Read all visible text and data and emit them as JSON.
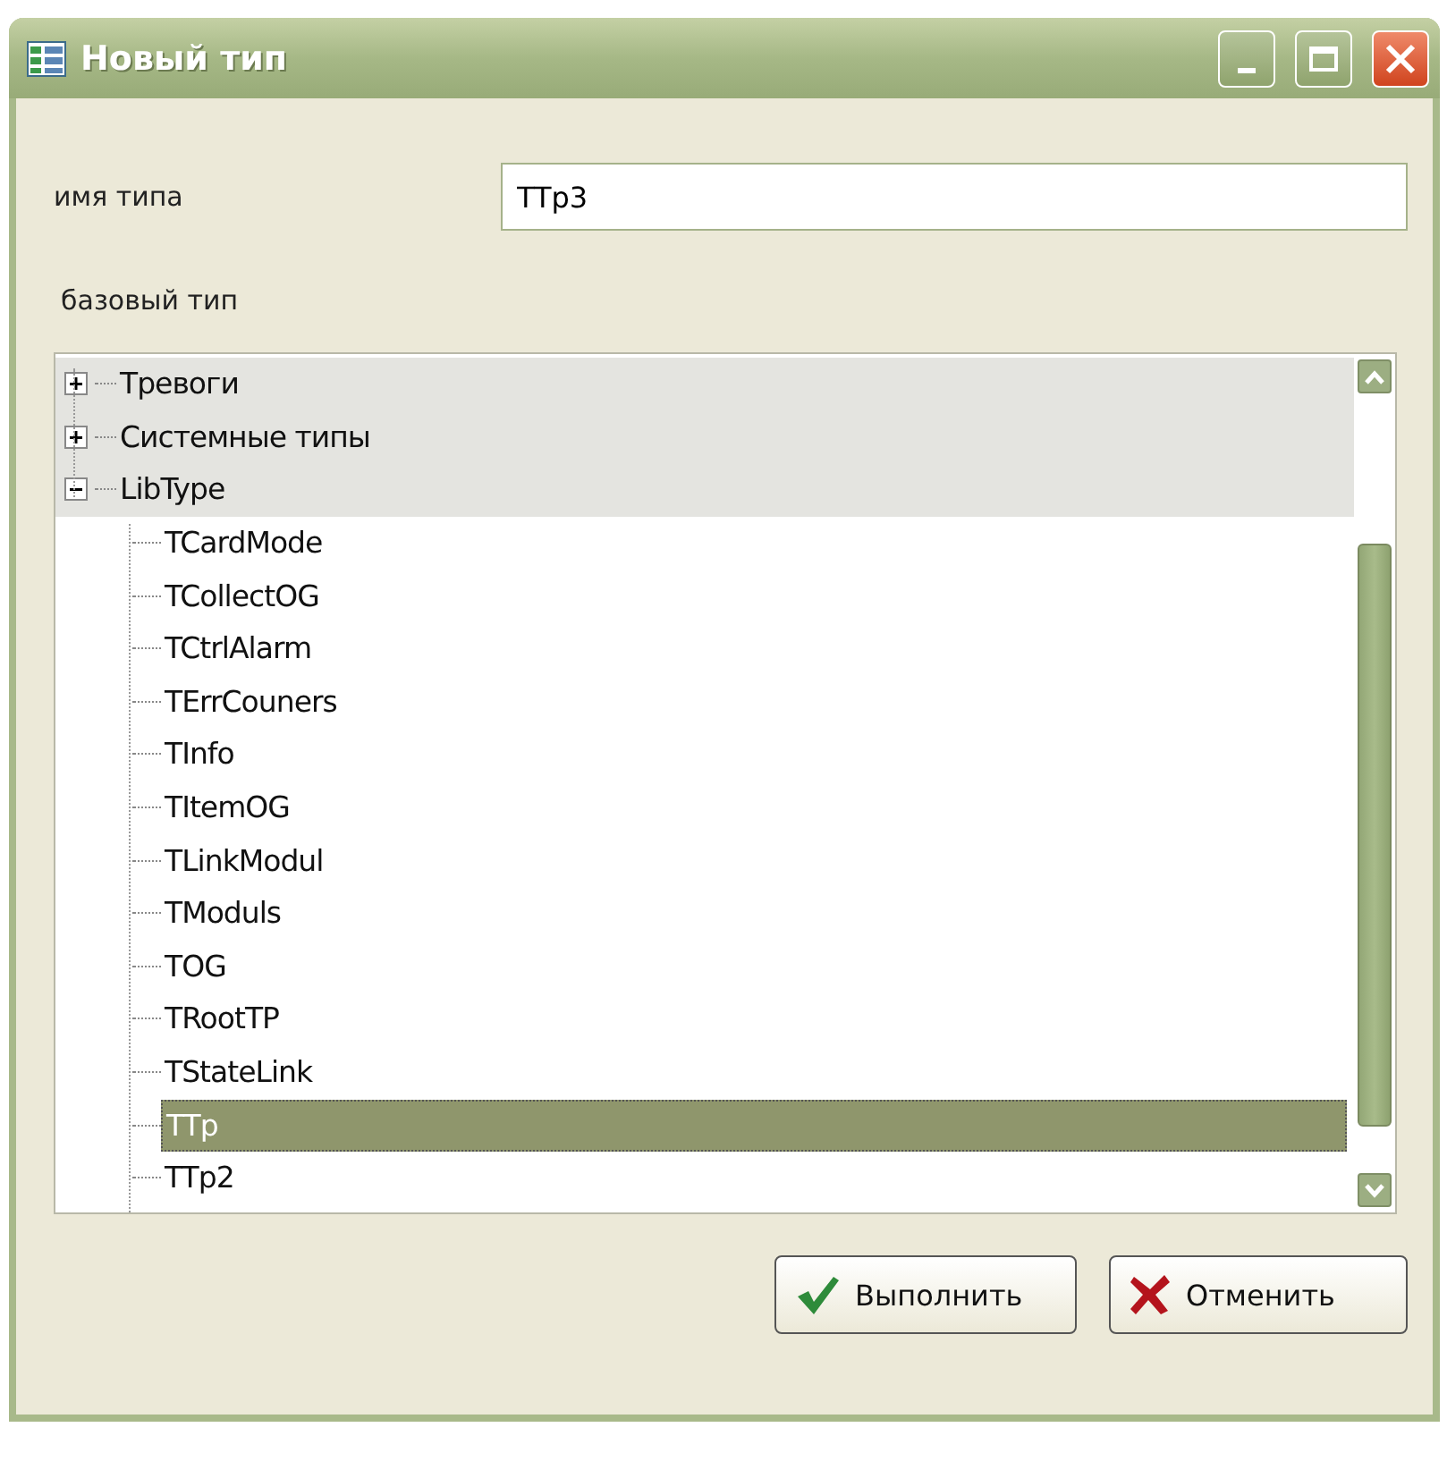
{
  "window": {
    "title": "Новый тип"
  },
  "type_name": {
    "label": "имя типа",
    "value": "TTp3"
  },
  "base_type": {
    "label": "базовый тип",
    "tree": [
      {
        "label": "Тревоги",
        "expanded": false,
        "selected": false
      },
      {
        "label": "Системные типы",
        "expanded": false,
        "selected": false
      },
      {
        "label": "LibType",
        "expanded": true,
        "selected": false,
        "children": [
          {
            "label": "TCardMode",
            "selected": false
          },
          {
            "label": "TCollectOG",
            "selected": false
          },
          {
            "label": "TCtrlAlarm",
            "selected": false
          },
          {
            "label": "TErrCouners",
            "selected": false
          },
          {
            "label": "TInfo",
            "selected": false
          },
          {
            "label": "TItemOG",
            "selected": false
          },
          {
            "label": "TLinkModul",
            "selected": false
          },
          {
            "label": "TModuls",
            "selected": false
          },
          {
            "label": "TOG",
            "selected": false
          },
          {
            "label": "TRootTP",
            "selected": false
          },
          {
            "label": "TStateLink",
            "selected": false
          },
          {
            "label": "TTp",
            "selected": true
          },
          {
            "label": "TTp2",
            "selected": false
          }
        ]
      }
    ]
  },
  "buttons": [
    {
      "kind": "ok",
      "label": "Выполнить"
    },
    {
      "kind": "cancel",
      "label": "Отменить"
    }
  ]
}
